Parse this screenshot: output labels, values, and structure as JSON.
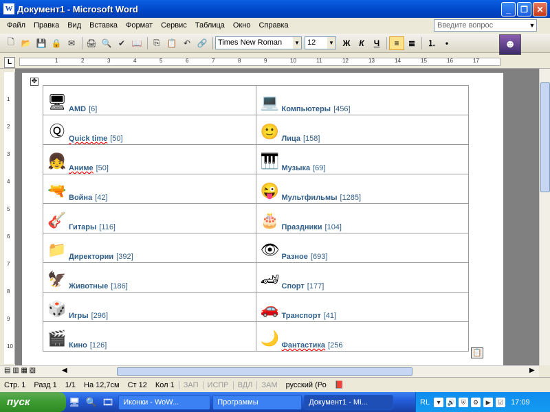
{
  "window": {
    "title": "Документ1 - Microsoft Word",
    "app_icon": "W"
  },
  "menu": [
    "Файл",
    "Правка",
    "Вид",
    "Вставка",
    "Формат",
    "Сервис",
    "Таблица",
    "Окно",
    "Справка"
  ],
  "ask_placeholder": "Введите вопрос",
  "toolbar": {
    "font": "Times New Roman",
    "size": "12",
    "bold": "Ж",
    "italic": "К",
    "underline": "Ч"
  },
  "ruler": {
    "numbers": [
      "1",
      "2",
      "3",
      "4",
      "5",
      "6",
      "7",
      "8",
      "9",
      "10",
      "11",
      "12",
      "13",
      "14",
      "15",
      "16",
      "17"
    ]
  },
  "categories": [
    {
      "left": {
        "name": "AMD",
        "count": "[6]",
        "icon": "🖥"
      },
      "right": {
        "name": "Компьютеры",
        "count": "[456]",
        "icon": "💻"
      }
    },
    {
      "left": {
        "name": "Quick time",
        "count": "[50]",
        "icon": "Ⓠ"
      },
      "right": {
        "name": "Лица",
        "count": "[158]",
        "icon": "🙂"
      }
    },
    {
      "left": {
        "name": "Аниме",
        "count": "[50]",
        "icon": "👧"
      },
      "right": {
        "name": "Музыка",
        "count": "[69]",
        "icon": "🎹"
      }
    },
    {
      "left": {
        "name": "Война",
        "count": "[42]",
        "icon": "🔫"
      },
      "right": {
        "name": "Мультфильмы",
        "count": "[1285]",
        "icon": "😜"
      }
    },
    {
      "left": {
        "name": "Гитары",
        "count": "[116]",
        "icon": "🎸"
      },
      "right": {
        "name": "Праздники",
        "count": "[104]",
        "icon": "🎂"
      }
    },
    {
      "left": {
        "name": "Директории",
        "count": "[392]",
        "icon": "📁"
      },
      "right": {
        "name": "Разное",
        "count": "[693]",
        "icon": "👁"
      }
    },
    {
      "left": {
        "name": "Животные",
        "count": "[186]",
        "icon": "🦅"
      },
      "right": {
        "name": "Спорт",
        "count": "[177]",
        "icon": "🏎"
      }
    },
    {
      "left": {
        "name": "Игры",
        "count": "[296]",
        "icon": "🎲"
      },
      "right": {
        "name": "Транспорт",
        "count": "[41]",
        "icon": "🚗"
      }
    },
    {
      "left": {
        "name": "Кино",
        "count": "[126]",
        "icon": "🎬"
      },
      "right": {
        "name": "Фантастика",
        "count": "[256",
        "icon": "🌙"
      }
    }
  ],
  "status": {
    "page": "Стр. 1",
    "section": "Разд 1",
    "pages": "1/1",
    "position": "На 12,7см",
    "line": "Ст 12",
    "col": "Кол 1",
    "rec": "ЗАП",
    "trk": "ИСПР",
    "ext": "ВДЛ",
    "ovr": "ЗАМ",
    "lang": "русский (Ро"
  },
  "taskbar": {
    "start": "пуск",
    "tasks": [
      "Иконки - WoW...",
      "Программы",
      "Документ1 - Mi..."
    ],
    "lang": "RL",
    "time": "17:09"
  }
}
